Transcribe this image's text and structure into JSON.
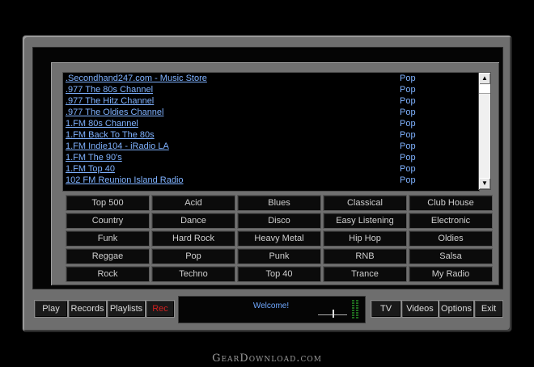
{
  "stations": [
    {
      "name": ".Secondhand247.com - Music Store",
      "genre": "Pop"
    },
    {
      "name": ".977 The 80s Channel",
      "genre": "Pop"
    },
    {
      "name": ".977 The Hitz Channel",
      "genre": "Pop"
    },
    {
      "name": ".977 The Oldies Channel",
      "genre": "Pop"
    },
    {
      "name": "1.FM  80s Channel",
      "genre": "Pop"
    },
    {
      "name": "1.FM  Back To The 80s",
      "genre": "Pop"
    },
    {
      "name": "1.FM  Indie104 - iRadio LA",
      "genre": "Pop"
    },
    {
      "name": "1.FM  The 90's",
      "genre": "Pop"
    },
    {
      "name": "1.FM  Top 40",
      "genre": "Pop"
    },
    {
      "name": "102 FM Reunion Island Radio",
      "genre": "Pop"
    }
  ],
  "genres": [
    "Top 500",
    "Acid",
    "Blues",
    "Classical",
    "Club House",
    "Country",
    "Dance",
    "Disco",
    "Easy Listening",
    "Electronic",
    "Funk",
    "Hard Rock",
    "Heavy Metal",
    "Hip Hop",
    "Oldies",
    "Reggae",
    "Pop",
    "Punk",
    "RNB",
    "Salsa",
    "Rock",
    "Techno",
    "Top 40",
    "Trance",
    "My Radio"
  ],
  "controls": {
    "play": "Play",
    "records": "Records",
    "playlists": "Playlists",
    "rec": "Rec",
    "tv": "TV",
    "videos": "Videos",
    "options": "Options",
    "exit": "Exit"
  },
  "display": {
    "status": "Welcome!"
  },
  "watermark": "GearDownload.com",
  "colors": {
    "link": "#7fb2ff",
    "rec": "#d02020",
    "meter": "#1f6b1f"
  }
}
